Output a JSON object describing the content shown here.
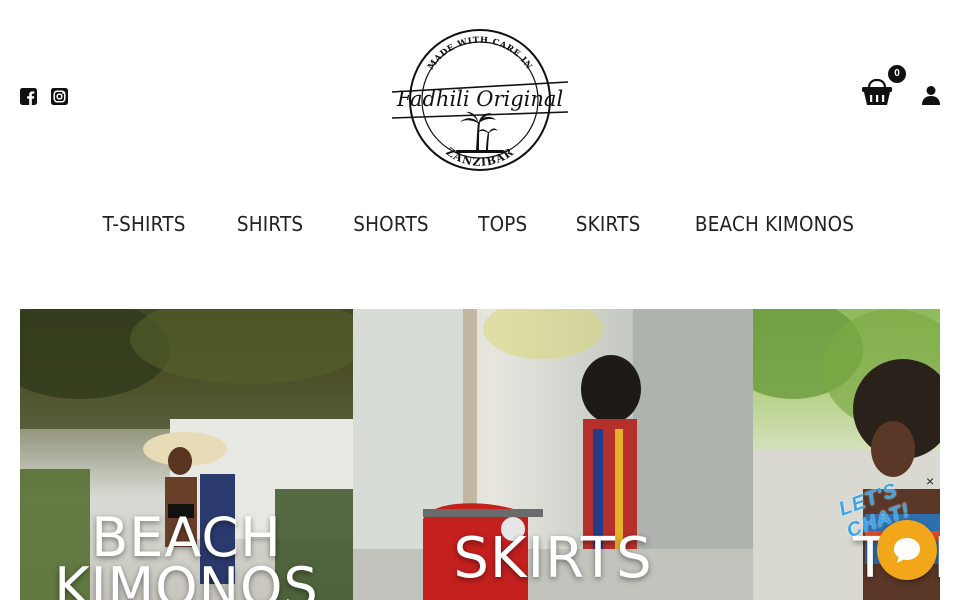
{
  "header": {
    "logo": {
      "top_text": "MADE WITH CARE IN",
      "brand": "Fadhili Original",
      "bottom_text": "ZANZIBAR"
    },
    "social": [
      {
        "name": "facebook-icon"
      },
      {
        "name": "instagram-icon"
      }
    ],
    "cart": {
      "count": "0",
      "icon": "shopping-basket-icon"
    },
    "account": {
      "icon": "user-icon"
    }
  },
  "nav": {
    "items": [
      {
        "label": "T-SHIRTS"
      },
      {
        "label": "SHIRTS"
      },
      {
        "label": "SHORTS"
      },
      {
        "label": "TOPS"
      },
      {
        "label": "SKIRTS"
      },
      {
        "label": "BEACH KIMONOS"
      }
    ]
  },
  "tiles": [
    {
      "line1": "BEACH",
      "line2": "KIMONOS"
    },
    {
      "line1": "SKIRTS"
    },
    {
      "line1": "TOPS"
    }
  ],
  "chat": {
    "prompt": "LET'S CHAT!",
    "close": "×",
    "accent": "#f2a71b"
  }
}
